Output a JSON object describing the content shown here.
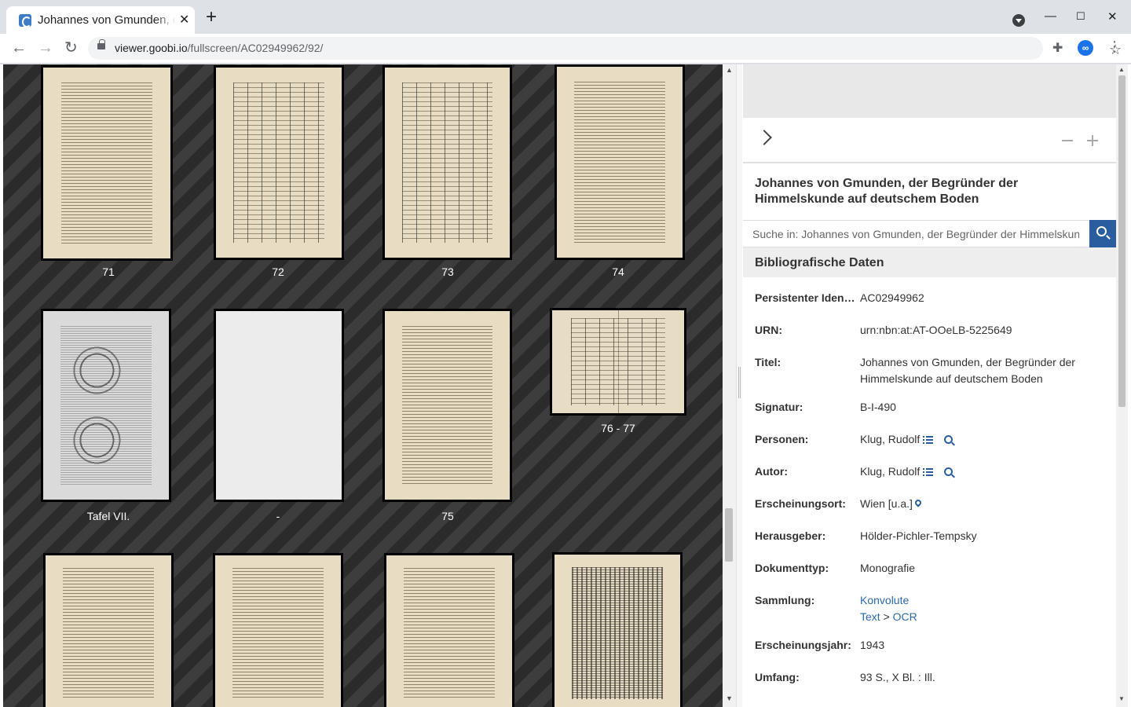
{
  "browser": {
    "tab_title": "Johannes von Gmunden, der Begründer der Himmelskunde auf deutschem Boden",
    "url_host": "viewer.goobi.io",
    "url_path": "/fullscreen/AC02949962/92/"
  },
  "thumbnails": [
    {
      "label": "71"
    },
    {
      "label": "72"
    },
    {
      "label": "73"
    },
    {
      "label": "74"
    },
    {
      "label": "Tafel VII."
    },
    {
      "label": "-"
    },
    {
      "label": "75"
    },
    {
      "label": "76 - 77"
    },
    {
      "label": ""
    },
    {
      "label": ""
    },
    {
      "label": ""
    },
    {
      "label": ""
    }
  ],
  "sidebar": {
    "title": "Johannes von Gmunden, der Begründer der Himmelskunde auf deutschem Boden",
    "search_placeholder": "Suche in: Johannes von Gmunden, der Begründer der Himmelskunde auf deutschem Boden",
    "section_title": "Bibliografische Daten",
    "fields": {
      "pid_label": "Persistenter Identifikator:",
      "pid_value": "AC02949962",
      "urn_label": "URN:",
      "urn_value": "urn:nbn:at:AT-OOeLB-5225649",
      "titel_label": "Titel:",
      "titel_value": "Johannes von Gmunden, der Begründer der Himmelskunde auf deutschem Boden",
      "signatur_label": "Signatur:",
      "signatur_value": "B-I-490",
      "personen_label": "Personen:",
      "personen_value": "Klug, Rudolf",
      "autor_label": "Autor:",
      "autor_value": "Klug, Rudolf",
      "ort_label": "Erscheinungsort:",
      "ort_value": "Wien [u.a.]",
      "hrsg_label": "Herausgeber:",
      "hrsg_value": "Hölder-Pichler-Tempsky",
      "typ_label": "Dokumenttyp:",
      "typ_value": "Monografie",
      "sammlung_label": "Sammlung:",
      "sammlung_1": "Konvolute",
      "sammlung_2a": "Text",
      "sammlung_sep": " > ",
      "sammlung_2b": "OCR",
      "jahr_label": "Erscheinungsjahr:",
      "jahr_value": "1943",
      "umfang_label": "Umfang:",
      "umfang_value": "93 S., X Bl. : Ill."
    }
  },
  "colors": {
    "accent": "#2a5d9f",
    "link": "#2a6ba8"
  }
}
